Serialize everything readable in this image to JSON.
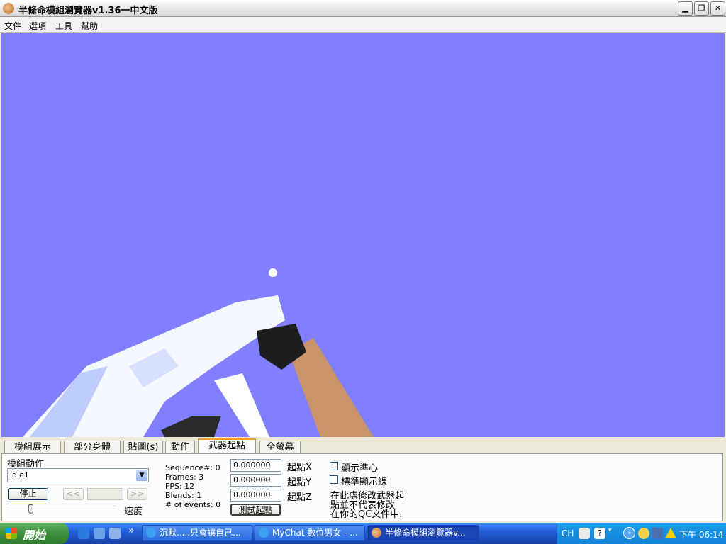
{
  "window": {
    "title": "半條命模組瀏覽器v1.36一中文版"
  },
  "menu": {
    "items": [
      "文件",
      "選項",
      "工具",
      "幫助"
    ]
  },
  "tabs": [
    "模組展示",
    "部分身體",
    "貼圖(s)",
    "動作",
    "武器起點",
    "全螢幕"
  ],
  "active_tab": 4,
  "panel": {
    "group_label": "模組動作",
    "sequence_value": "idle1",
    "stop_button": "停止",
    "prev_button": "<<",
    "next_button": ">>",
    "speed_label": "速度",
    "speed_level": 0.2,
    "info": [
      "Sequence#: 0",
      "Frames: 3",
      "FPS: 12",
      "Blends: 1",
      "# of events: 0"
    ],
    "origin_x": "0.000000",
    "origin_y": "0.000000",
    "origin_z": "0.000000",
    "origin_x_label": "起點X",
    "origin_y_label": "起點Y",
    "origin_z_label": "起點Z",
    "test_button": "測試起點",
    "show_crosshair": "顯示準心",
    "show_guides": "標準顯示線",
    "note_lines": [
      "在此處修改武器起",
      "點並不代表修改",
      "在你的QC文件中."
    ]
  },
  "taskbar": {
    "start_label": "開始",
    "tasks": [
      "沉默.....只會讓自己...",
      "MyChat 數位男女 - ...",
      "半條命模組瀏覽器v..."
    ],
    "active_task": 2,
    "language": "CH",
    "clock": "下午 06:14"
  },
  "colors": {
    "viewport_bg": "#8080ff",
    "taskbar": "#245edb",
    "start": "#3c8f3c",
    "tray": "#1483d8"
  }
}
